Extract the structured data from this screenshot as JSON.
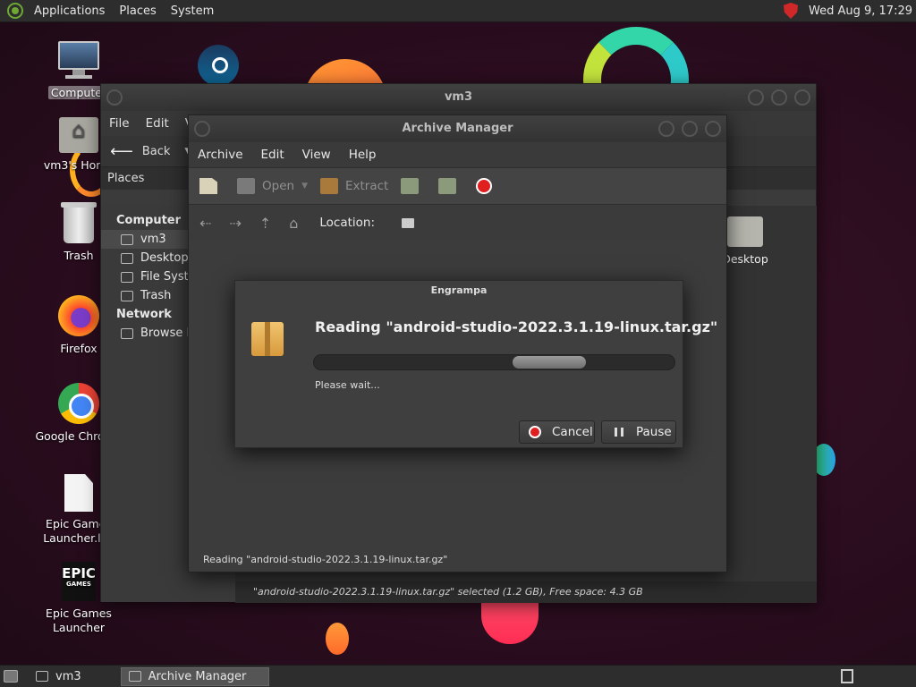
{
  "top_panel": {
    "menus": [
      "Applications",
      "Places",
      "System"
    ],
    "clock": "Wed Aug  9, 17:29"
  },
  "desktop": {
    "icons": [
      {
        "label": "Computer",
        "icon": "computer-icon"
      },
      {
        "label": "vm3's Home",
        "icon": "home-folder-icon"
      },
      {
        "label": "Trash",
        "icon": "trash-icon"
      },
      {
        "label": "Firefox",
        "icon": "firefox-icon"
      },
      {
        "label": "Google Chrome",
        "icon": "chrome-icon"
      },
      {
        "label": "Epic Games Launcher.lnk",
        "icon": "file-icon"
      },
      {
        "label": "Epic Games Launcher",
        "icon": "epic-games-icon"
      },
      {
        "label": "",
        "icon": "steam-icon"
      }
    ],
    "epic_logo": {
      "line1": "EPIC",
      "line2": "GAMES"
    }
  },
  "vm3_window": {
    "title": "vm3",
    "menus": [
      "File",
      "Edit",
      "V"
    ],
    "back_label": "Back",
    "places_label": "Places",
    "sidebar": {
      "computer_header": "Computer",
      "computer_items": [
        "vm3",
        "Desktop",
        "File System",
        "Trash"
      ],
      "network_header": "Network",
      "network_items": [
        "Browse Network"
      ]
    },
    "folder_label": "Desktop",
    "status": "\"android-studio-2022.3.1.19-linux.tar.gz\" selected (1.2 GB), Free space: 4.3 GB"
  },
  "archive_window": {
    "title": "Archive Manager",
    "menus": [
      "Archive",
      "Edit",
      "View",
      "Help"
    ],
    "toolbar": {
      "open_label": "Open",
      "extract_label": "Extract"
    },
    "location_label": "Location:",
    "status": "Reading \"android-studio-2022.3.1.19-linux.tar.gz\""
  },
  "progress_dialog": {
    "title": "Engrampa",
    "heading": "Reading \"android-studio-2022.3.1.19-linux.tar.gz\"",
    "subtext": "Please wait...",
    "cancel_label": "Cancel",
    "pause_label": "Pause"
  },
  "taskbar": {
    "tasks": [
      {
        "label": "vm3",
        "active": false
      },
      {
        "label": "Archive Manager",
        "active": true
      }
    ]
  },
  "colors": {
    "panel": "#2d2d2d",
    "window": "#3b3b3b",
    "stop_red": "#e02020",
    "desktop_bg": "#2b0d1f"
  }
}
